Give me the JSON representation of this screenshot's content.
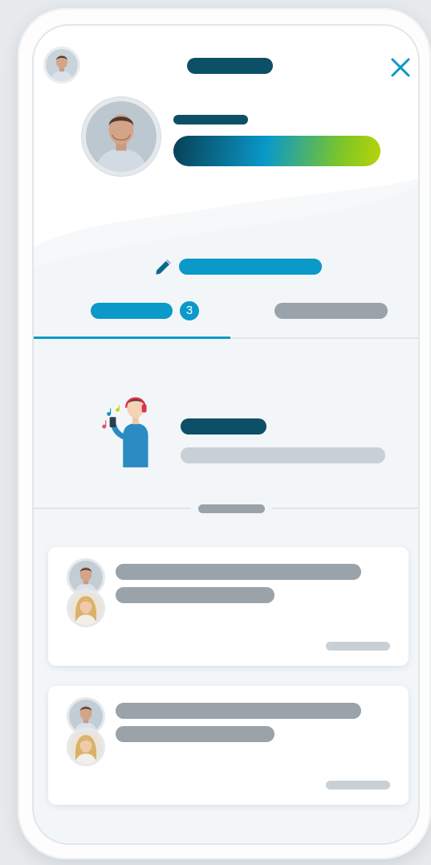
{
  "colors": {
    "brand_dark": "#0b5066",
    "accent": "#0a99c9",
    "gradient_start": "#083f55",
    "gradient_mid": "#0a99c9",
    "gradient_end": "#b9d406",
    "muted": "#9aa3aa",
    "muted_light": "#c9d0d5"
  },
  "icons": {
    "close": "close-icon",
    "edit": "pencil-icon",
    "illustration": "person-with-phone-illustration"
  },
  "tabs": [
    {
      "badge": "3",
      "active": true
    },
    {
      "active": false
    }
  ]
}
